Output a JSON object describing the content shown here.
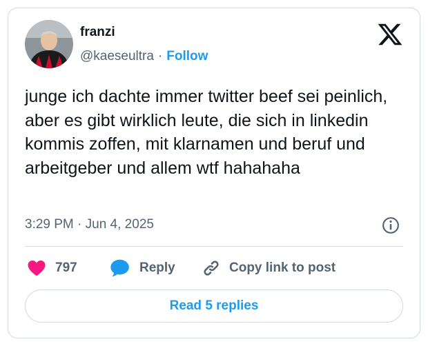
{
  "author": {
    "name": "franzi",
    "handle": "@kaeseultra",
    "separator": "·",
    "follow_label": "Follow"
  },
  "tweet": {
    "text": "junge ich dachte immer twitter beef sei peinlich, aber es gibt wirklich leute, die sich in linkedin kommis zoffen, mit klarnamen und beruf und arbeitgeber und allem wtf hahahaha",
    "timestamp": "3:29 PM · Jun 4, 2025"
  },
  "actions": {
    "like_count": "797",
    "reply_label": "Reply",
    "copy_label": "Copy link to post"
  },
  "read_replies_label": "Read 5 replies",
  "icons": {
    "logo": "x-logo-icon",
    "info": "info-icon",
    "like": "heart-icon",
    "reply": "speech-bubble-icon",
    "copy": "link-icon"
  },
  "colors": {
    "accent": "#1d9bf0",
    "like": "#f91880",
    "muted": "#536471",
    "text": "#0f1419",
    "border": "#cfd9de"
  }
}
